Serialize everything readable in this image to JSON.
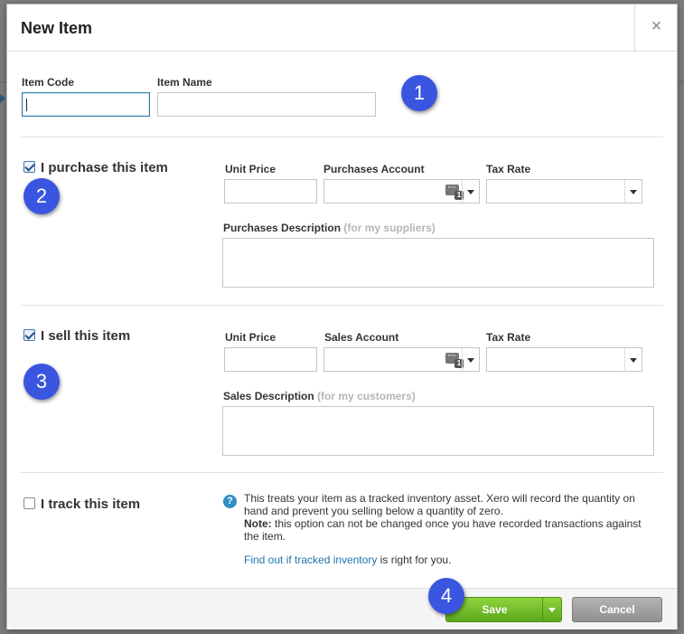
{
  "dialog": {
    "title": "New Item",
    "close_label": "×"
  },
  "item": {
    "code_label": "Item Code",
    "code_value": "",
    "name_label": "Item Name",
    "name_value": ""
  },
  "purchase": {
    "checkbox_label": "I purchase this item",
    "checked": true,
    "unit_price_label": "Unit Price",
    "account_label": "Purchases Account",
    "tax_rate_label": "Tax Rate",
    "description_label": "Purchases Description",
    "description_hint": "(for my suppliers)"
  },
  "sales": {
    "checkbox_label": "I sell this item",
    "checked": true,
    "unit_price_label": "Unit Price",
    "account_label": "Sales Account",
    "tax_rate_label": "Tax Rate",
    "description_label": "Sales Description",
    "description_hint": "(for my customers)"
  },
  "track": {
    "checkbox_label": "I track this item",
    "checked": false,
    "help_icon": "?",
    "info_text": "This treats your item as a tracked inventory asset. Xero will record the quantity on hand and prevent you selling below a quantity of zero.",
    "note_label": "Note:",
    "note_text": " this option can not be changed once you have recorded transactions against the item.",
    "link_text": "Find out if tracked inventory",
    "link_suffix": " is right for you."
  },
  "account_icon": {
    "badge": "1"
  },
  "badges": [
    "1",
    "2",
    "3",
    "4"
  ],
  "footer": {
    "save_label": "Save",
    "cancel_label": "Cancel"
  },
  "colors": {
    "save_green": "#6dbb26",
    "badge_blue": "#3a55e0",
    "link_blue": "#1f74b0"
  }
}
